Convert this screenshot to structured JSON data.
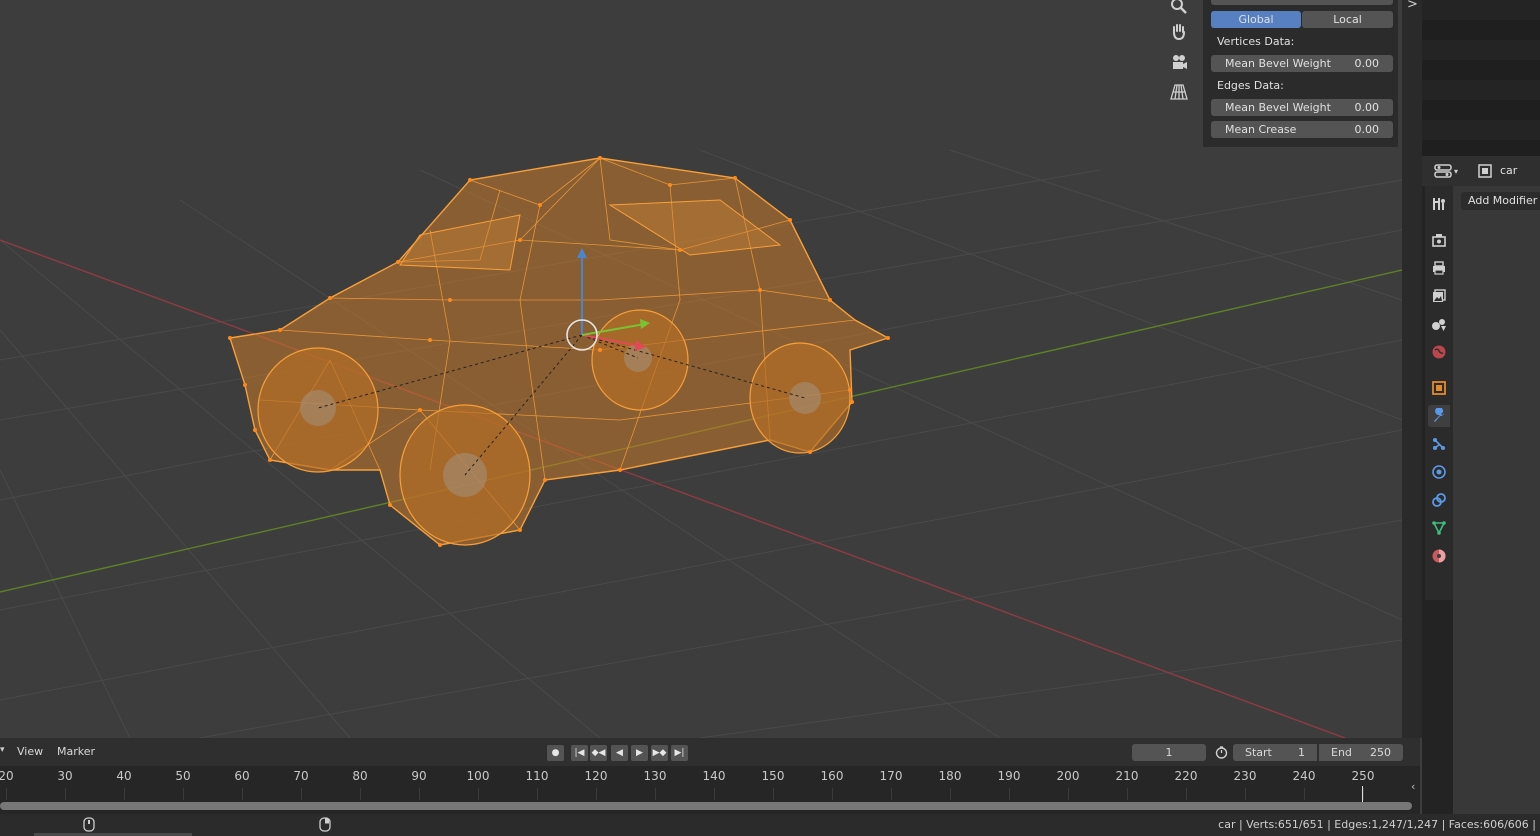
{
  "viewport": {
    "nav_icons": [
      "zoom-icon",
      "hand-pan-icon",
      "camera-icon",
      "perspective-grid-icon"
    ]
  },
  "n_panel": {
    "orientation": {
      "global_label": "Global",
      "local_label": "Local",
      "active": "Global"
    },
    "vertices_heading": "Vertices Data:",
    "vertex_bevel": {
      "label": "Mean Bevel Weight",
      "value": "0.00"
    },
    "edges_heading": "Edges Data:",
    "edge_bevel": {
      "label": "Mean Bevel Weight",
      "value": "0.00"
    },
    "edge_crease": {
      "label": "Mean Crease",
      "value": "0.00"
    }
  },
  "sidebar_toggle": ">",
  "properties": {
    "object_name": "car",
    "add_modifier_label": "Add Modifier",
    "active_tab": "modifier",
    "tabs": [
      "tool",
      "render",
      "output",
      "view-layer",
      "scene",
      "world",
      "object",
      "modifier",
      "particles",
      "physics",
      "constraints",
      "data",
      "material"
    ]
  },
  "timeline": {
    "menu_view": "View",
    "menu_marker": "Marker",
    "current_frame": "1",
    "start_label": "Start",
    "start_value": "1",
    "end_label": "End",
    "end_value": "250",
    "ticks": [
      "20",
      "30",
      "40",
      "50",
      "60",
      "70",
      "80",
      "90",
      "100",
      "110",
      "120",
      "130",
      "140",
      "150",
      "160",
      "170",
      "180",
      "190",
      "200",
      "210",
      "220",
      "230",
      "240",
      "250"
    ]
  },
  "status": {
    "text": "car | Verts:651/651 | Edges:1,247/1,247 | Faces:606/606 |"
  },
  "colors": {
    "accent": "#5680c2",
    "selection": "#f7a03a",
    "x_axis": "#b3454d",
    "y_axis": "#6d9a2b"
  }
}
